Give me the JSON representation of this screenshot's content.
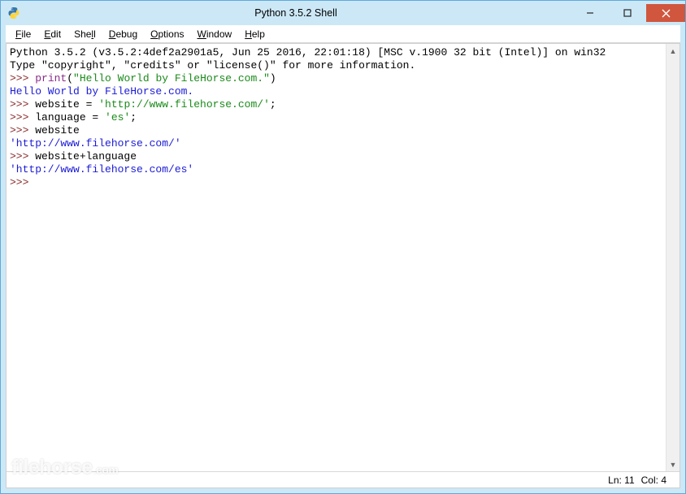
{
  "window": {
    "title": "Python 3.5.2 Shell"
  },
  "menu": {
    "file": "File",
    "edit": "Edit",
    "shell": "Shell",
    "debug": "Debug",
    "options": "Options",
    "window": "Window",
    "help": "Help"
  },
  "code": {
    "banner1": "Python 3.5.2 (v3.5.2:4def2a2901a5, Jun 25 2016, 22:01:18) [MSC v.1900 32 bit (Intel)] on win32",
    "banner2": "Type \"copyright\", \"credits\" or \"license()\" for more information.",
    "p1": ">>> ",
    "print_kw": "print",
    "print_open": "(",
    "print_arg": "\"Hello World by FileHorse.com.\"",
    "print_close": ")",
    "out1": "Hello World by FileHorse.com.",
    "l3a": "website = ",
    "l3b": "'http://www.filehorse.com/'",
    "l3c": ";",
    "l4a": "language = ",
    "l4b": "'es'",
    "l4c": ";",
    "l5": "website",
    "out2": "'http://www.filehorse.com/'",
    "l6": "website+language",
    "out3": "'http://www.filehorse.com/es'",
    "empty": ""
  },
  "status": {
    "ln": "Ln: 11",
    "col": "Col: 4"
  },
  "watermark": {
    "name": "filehorse",
    "tld": ".com"
  }
}
